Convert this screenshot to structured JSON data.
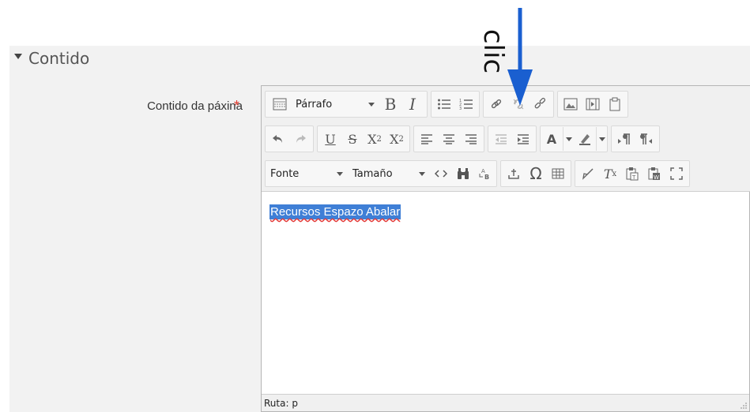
{
  "section": {
    "title": "Contido"
  },
  "field": {
    "label": "Contido da páxina",
    "required_marker": "*"
  },
  "toolbar": {
    "row1": {
      "format_select": "Párrafo",
      "buttons": [
        "toolbar-toggle",
        "bold",
        "italic",
        "unordered-list",
        "ordered-list",
        "link",
        "unlink",
        "manage-files",
        "image",
        "media",
        "copy-paste"
      ]
    },
    "row2": {
      "buttons": [
        "undo",
        "redo",
        "underline",
        "strikethrough",
        "subscript",
        "superscript",
        "align-left",
        "align-center",
        "align-right",
        "outdent",
        "indent",
        "text-color",
        "background-color",
        "ltr",
        "rtl"
      ]
    },
    "row3": {
      "font_select": "Fonte",
      "size_select": "Tamaño",
      "buttons": [
        "html-source",
        "find",
        "find-replace",
        "insert-anchor",
        "special-character",
        "table",
        "cleanup",
        "clear-formatting",
        "paste-text",
        "paste-word",
        "fullscreen"
      ]
    },
    "subscript_label": "X",
    "sub_suffix": "2",
    "superscript_label": "X",
    "sup_suffix": "2",
    "bold_label": "B",
    "italic_label": "I",
    "underline_label": "U",
    "strike_label": "S",
    "omega_label": "Ω",
    "text_color_label": "A",
    "clear_label": "T"
  },
  "editor": {
    "content": "Recursos Espazo Abalar",
    "path_label": "Ruta: p"
  },
  "annotation": {
    "text": "clic",
    "arrow_color": "#1a5fd0"
  },
  "colors": {
    "required": "#e0382c",
    "selection": "#3f7fd6"
  }
}
